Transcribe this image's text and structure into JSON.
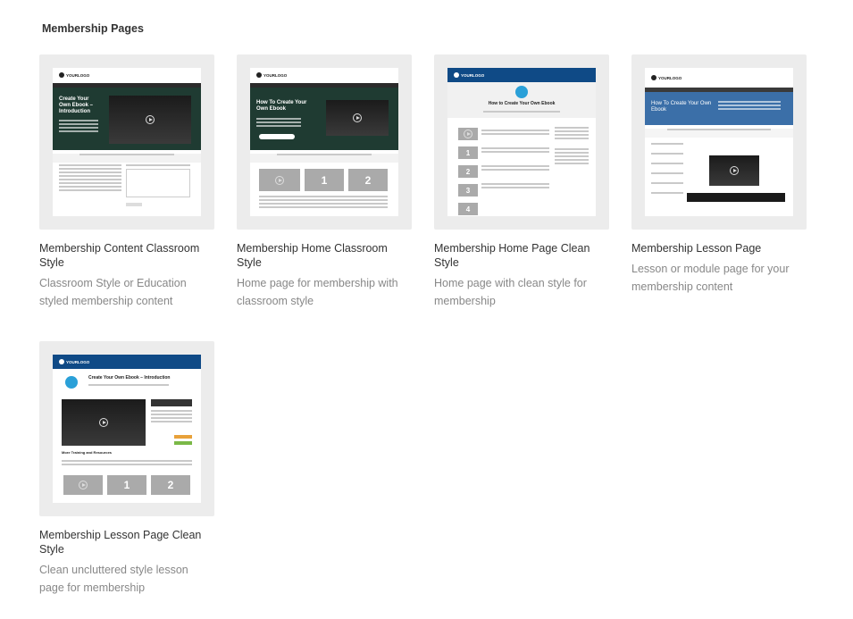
{
  "section": {
    "title": "Membership Pages"
  },
  "cards": [
    {
      "title": "Membership Content Classroom Style",
      "description": "Classroom Style or Education styled membership content"
    },
    {
      "title": "Membership Home Classroom Style",
      "description": "Home page for membership with classroom style"
    },
    {
      "title": "Membership Home Page Clean Style",
      "description": "Home page with clean style for membership"
    },
    {
      "title": "Membership Lesson Page",
      "description": "Lesson or module page for your membership content"
    },
    {
      "title": "Membership Lesson Page Clean Style",
      "description": "Clean uncluttered style lesson page for membership"
    }
  ],
  "thumbs": {
    "logo_text": "YOURLOGO",
    "t1_heading": "Create Your Own Ebook – Introduction",
    "t2_heading": "How To Create Your Own Ebook",
    "t3_heading": "How to Create Your Own Ebook",
    "t4_heading": "How To Create Your Own Ebook",
    "t5_heading": "Create Your Own Ebook – Introduction",
    "t5_section": "More Training and Resources",
    "n1": "1",
    "n2": "2",
    "n3": "3",
    "n4": "4"
  },
  "colors": {
    "frame": "#ececec",
    "title": "#333333",
    "desc": "#888888",
    "green_hero": "#1f3b32",
    "blue_bar": "#0f4a86",
    "blue_hero": "#3b6fa8",
    "accent": "#2aa0d8"
  }
}
